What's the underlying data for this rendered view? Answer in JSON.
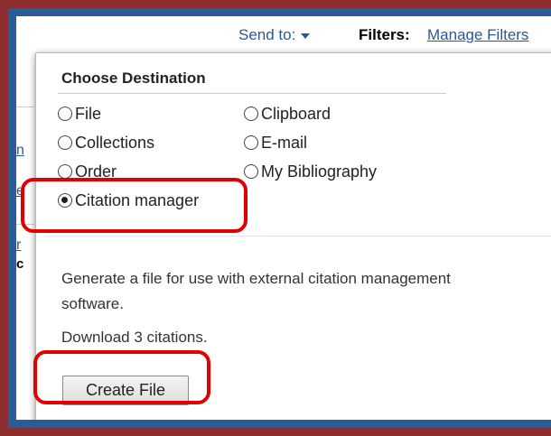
{
  "toolbar": {
    "send_to_label": "Send to:",
    "filters_label": "Filters:",
    "manage_filters_link": "Manage Filters"
  },
  "background_fragments": {
    "frag1": "n",
    "frag2": "e",
    "frag3": "r",
    "frag4": "c",
    "right": "c"
  },
  "popup": {
    "title": "Choose Destination",
    "options": [
      {
        "label": "File",
        "selected": false
      },
      {
        "label": "Clipboard",
        "selected": false
      },
      {
        "label": "Collections",
        "selected": false
      },
      {
        "label": "E-mail",
        "selected": false
      },
      {
        "label": "Order",
        "selected": false
      },
      {
        "label": "My Bibliography",
        "selected": false
      },
      {
        "label": "Citation manager",
        "selected": true
      }
    ],
    "description": "Generate a file for use with external citation management software.",
    "download_text": "Download 3 citations.",
    "create_button": "Create File"
  },
  "colors": {
    "frame_outer": "#8c2e2e",
    "frame_inner": "#2a5c9a",
    "link": "#2b5797",
    "annotation": "#e00000"
  }
}
